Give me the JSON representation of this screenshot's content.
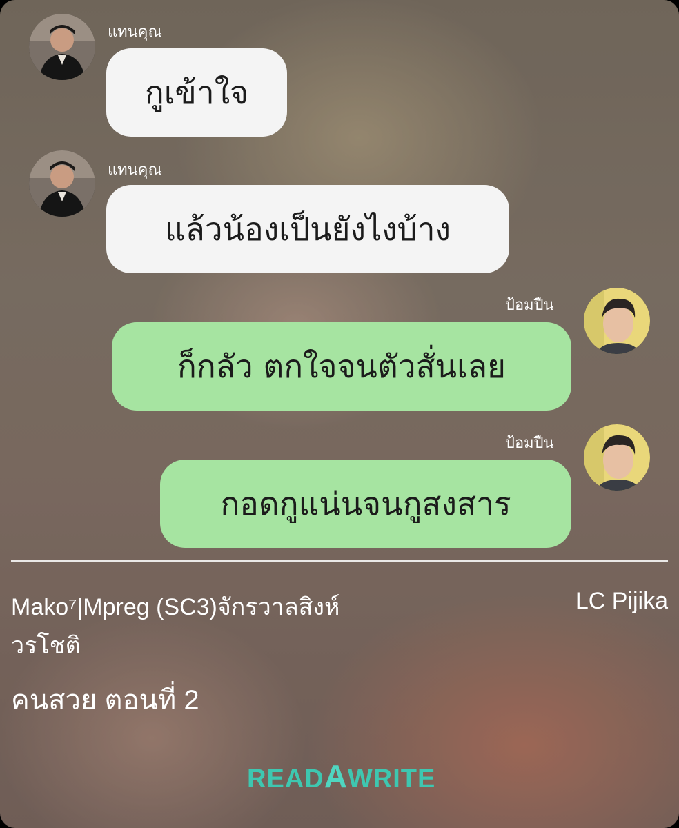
{
  "messages": [
    {
      "sender": "แทนคุณ",
      "text": "กูเข้าใจ",
      "side": "left"
    },
    {
      "sender": "แทนคุณ",
      "text": "แล้วน้องเป็นยังไงบ้าง",
      "side": "left"
    },
    {
      "sender": "ป้อมปืน",
      "text": "ก็กลัว ตกใจจนตัวสั่นเลย",
      "side": "right"
    },
    {
      "sender": "ป้อมปืน",
      "text": "กอดกูแน่นจนกูสงสาร",
      "side": "right"
    }
  ],
  "story": {
    "author_line1": "Mako⁷|Mpreg (SC3)จักรวาลสิงห์",
    "author_line2": "วรโชติ",
    "credit": "LC Pijika",
    "title": "คนสวย ตอนที่ 2"
  },
  "logo": {
    "part1": "READ",
    "part2": "A",
    "part3": "WRITE"
  },
  "colors": {
    "incoming_bubble": "#f4f4f4",
    "outgoing_bubble": "#a6e4a1",
    "logo": "#3ec7b0"
  },
  "icons": {
    "left_avatar": "person-avatar-dark-suit",
    "right_avatar": "person-avatar-light-background"
  }
}
